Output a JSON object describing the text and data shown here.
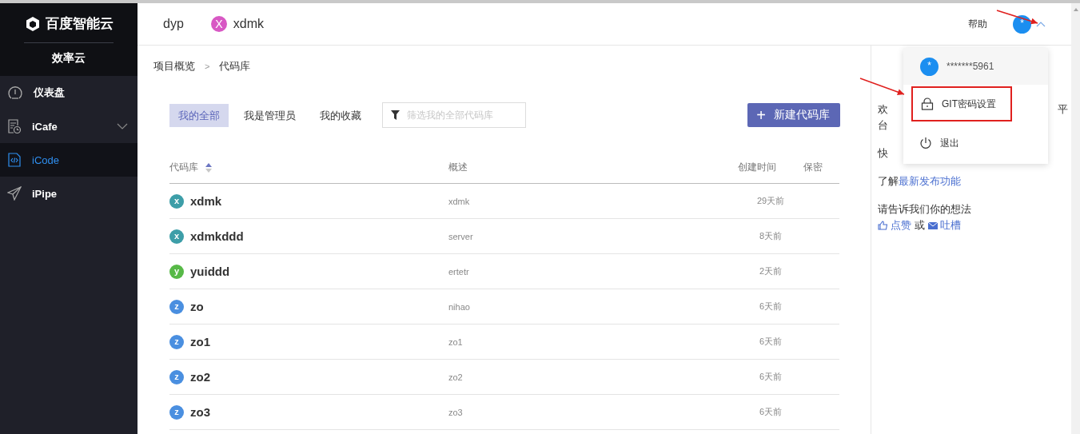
{
  "sidebar": {
    "logo": "百度智能云",
    "product": "效率云",
    "items": [
      {
        "label": "仪表盘",
        "selected": false,
        "expandable": false
      },
      {
        "label": "iCafe",
        "selected": false,
        "expandable": true
      },
      {
        "label": "iCode",
        "selected": true,
        "expandable": false
      },
      {
        "label": "iPipe",
        "selected": false,
        "expandable": false
      }
    ]
  },
  "header": {
    "projects": [
      {
        "label": "dyp"
      },
      {
        "label": "xdmk",
        "avatar": "X",
        "color": "#d858c4"
      }
    ],
    "help": "帮助",
    "avatar": "*",
    "menu_expanded": true,
    "arrow_annotated": true
  },
  "breadcrumb": [
    "项目概览",
    "代码库"
  ],
  "breadcrumb_separator": ">",
  "filters": [
    {
      "label": "我的全部",
      "selected": true
    },
    {
      "label": "我是管理员",
      "selected": false
    },
    {
      "label": "我的收藏",
      "selected": false
    }
  ],
  "search": {
    "placeholder": "筛选我的全部代码库"
  },
  "new_button": {
    "icon": "+",
    "label": "新建代码库"
  },
  "table": {
    "columns": [
      "代码库",
      "概述",
      "创建时间",
      "保密"
    ],
    "rows": [
      {
        "initial": "x",
        "color": "#3d9ea8",
        "name": "xdmk",
        "description": "xdmk",
        "created": "29天前"
      },
      {
        "initial": "x",
        "color": "#3d9ea8",
        "name": "xdmkddd",
        "description": "server",
        "created": "8天前"
      },
      {
        "initial": "y",
        "color": "#57b947",
        "name": "yuiddd",
        "description": "ertetr",
        "created": "2天前"
      },
      {
        "initial": "z",
        "color": "#4a8fe0",
        "name": "zo",
        "description": "nihao",
        "created": "6天前"
      },
      {
        "initial": "z",
        "color": "#4a8fe0",
        "name": "zo1",
        "description": "zo1",
        "created": "6天前"
      },
      {
        "initial": "z",
        "color": "#4a8fe0",
        "name": "zo2",
        "description": "zo2",
        "created": "6天前"
      },
      {
        "initial": "z",
        "color": "#4a8fe0",
        "name": "zo3",
        "description": "zo3",
        "created": "6天前"
      }
    ]
  },
  "side_panel": {
    "line_1_start": "欢",
    "line_1_end": "平",
    "line_2_start": "台",
    "line_3_start": "快",
    "learn": "了解",
    "learn_link": "最新发布功能",
    "feedback": "请告诉我们你的想法",
    "like": "点赞",
    "or": "或",
    "complain": "吐槽"
  },
  "user_menu": {
    "avatar": "*",
    "user": "*******5961",
    "items": [
      {
        "kind": "lock",
        "label": "GIT密码设置",
        "highlighted": true,
        "arrow_annotated": true
      },
      {
        "kind": "power",
        "label": "退出",
        "highlighted": false,
        "arrow_annotated": false
      }
    ]
  }
}
